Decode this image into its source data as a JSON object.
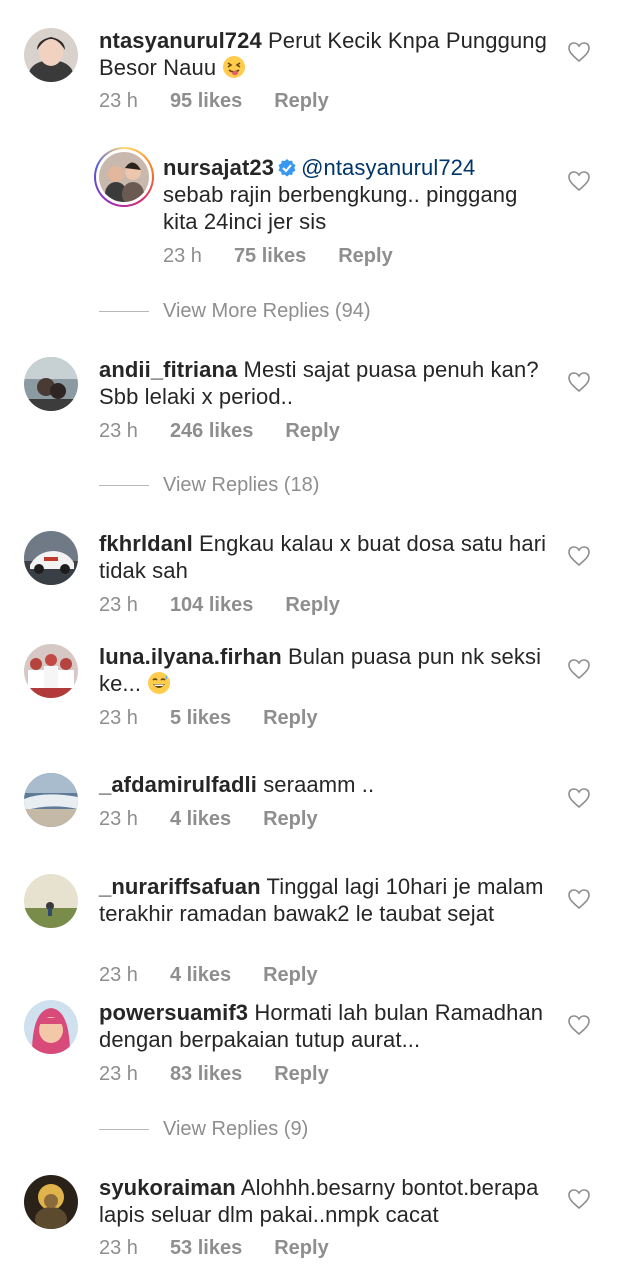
{
  "comments": [
    {
      "username": "ntasyanurul724",
      "text": "Perut Kecik Knpa Punggung Besor Nauu",
      "time": "23 h",
      "likes": "95 likes",
      "reply": "Reply",
      "emoji": "squinting-tongue-emoji"
    },
    {
      "username": "andii_fitriana",
      "text": "Mesti sajat puasa penuh kan? Sbb lelaki x period..",
      "time": "23 h",
      "likes": "246 likes",
      "reply": "Reply"
    },
    {
      "username": "fkhrldanl",
      "text": "Engkau kalau x buat dosa satu hari tidak sah",
      "time": "23 h",
      "likes": "104 likes",
      "reply": "Reply"
    },
    {
      "username": "luna.ilyana.firhan",
      "text": "Bulan puasa pun nk seksi ke...",
      "time": "23 h",
      "likes": "5 likes",
      "reply": "Reply",
      "emoji": "grinning-sweat-emoji"
    },
    {
      "username": "_afdamirulfadli",
      "text": "seraamm ..",
      "time": "23 h",
      "likes": "4 likes",
      "reply": "Reply"
    },
    {
      "username": "_nurariffsafuan",
      "text": "Tinggal lagi 10hari je malam terakhir ramadan bawak2 le taubat sejat",
      "time": "23 h",
      "likes": "4 likes",
      "reply": "Reply"
    },
    {
      "username": "powersuamif3",
      "text": "Hormati lah bulan Ramadhan dengan berpakaian tutup aurat...",
      "time": "23 h",
      "likes": "83 likes",
      "reply": "Reply"
    },
    {
      "username": "syukoraiman",
      "text": "Alohhh.besarny bontot.berapa lapis seluar dlm pakai..nmpk cacat",
      "time": "23 h",
      "likes": "53 likes",
      "reply": "Reply"
    }
  ],
  "reply_comment": {
    "username": "nursajat23",
    "mention": "@ntasyanurul724",
    "text": "sebab rajin berbengkung.. pinggang kita 24inci jer sis",
    "time": "23 h",
    "likes": "75 likes",
    "reply": "Reply",
    "verified_icon": "verified-badge-icon"
  },
  "view_more_replies": "View More Replies (94)",
  "view_replies_1": "View Replies (18)",
  "view_replies_2": "View Replies (9)",
  "colors": {
    "text": "#262626",
    "secondary": "#8e8e8e",
    "mention": "#003569",
    "verified": "#3897f0"
  }
}
